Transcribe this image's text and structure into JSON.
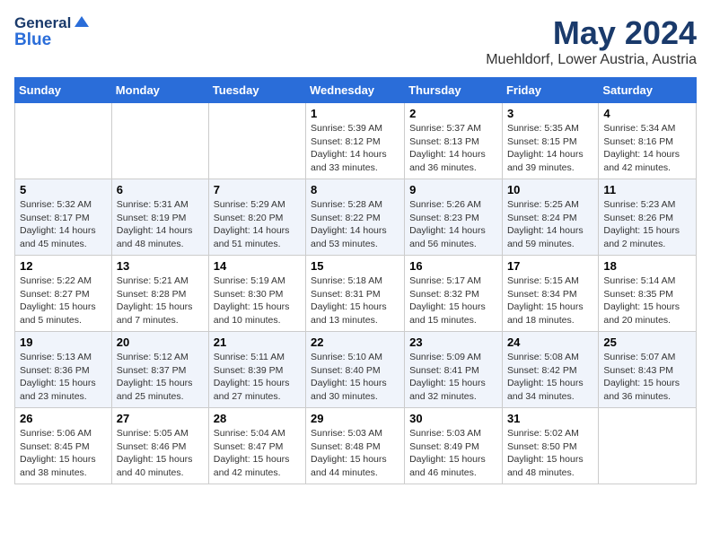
{
  "header": {
    "logo_general": "General",
    "logo_blue": "Blue",
    "month_title": "May 2024",
    "location": "Muehldorf, Lower Austria, Austria"
  },
  "days_of_week": [
    "Sunday",
    "Monday",
    "Tuesday",
    "Wednesday",
    "Thursday",
    "Friday",
    "Saturday"
  ],
  "weeks": [
    {
      "days": [
        {
          "num": "",
          "info": ""
        },
        {
          "num": "",
          "info": ""
        },
        {
          "num": "",
          "info": ""
        },
        {
          "num": "1",
          "info": "Sunrise: 5:39 AM\nSunset: 8:12 PM\nDaylight: 14 hours\nand 33 minutes."
        },
        {
          "num": "2",
          "info": "Sunrise: 5:37 AM\nSunset: 8:13 PM\nDaylight: 14 hours\nand 36 minutes."
        },
        {
          "num": "3",
          "info": "Sunrise: 5:35 AM\nSunset: 8:15 PM\nDaylight: 14 hours\nand 39 minutes."
        },
        {
          "num": "4",
          "info": "Sunrise: 5:34 AM\nSunset: 8:16 PM\nDaylight: 14 hours\nand 42 minutes."
        }
      ]
    },
    {
      "days": [
        {
          "num": "5",
          "info": "Sunrise: 5:32 AM\nSunset: 8:17 PM\nDaylight: 14 hours\nand 45 minutes."
        },
        {
          "num": "6",
          "info": "Sunrise: 5:31 AM\nSunset: 8:19 PM\nDaylight: 14 hours\nand 48 minutes."
        },
        {
          "num": "7",
          "info": "Sunrise: 5:29 AM\nSunset: 8:20 PM\nDaylight: 14 hours\nand 51 minutes."
        },
        {
          "num": "8",
          "info": "Sunrise: 5:28 AM\nSunset: 8:22 PM\nDaylight: 14 hours\nand 53 minutes."
        },
        {
          "num": "9",
          "info": "Sunrise: 5:26 AM\nSunset: 8:23 PM\nDaylight: 14 hours\nand 56 minutes."
        },
        {
          "num": "10",
          "info": "Sunrise: 5:25 AM\nSunset: 8:24 PM\nDaylight: 14 hours\nand 59 minutes."
        },
        {
          "num": "11",
          "info": "Sunrise: 5:23 AM\nSunset: 8:26 PM\nDaylight: 15 hours\nand 2 minutes."
        }
      ]
    },
    {
      "days": [
        {
          "num": "12",
          "info": "Sunrise: 5:22 AM\nSunset: 8:27 PM\nDaylight: 15 hours\nand 5 minutes."
        },
        {
          "num": "13",
          "info": "Sunrise: 5:21 AM\nSunset: 8:28 PM\nDaylight: 15 hours\nand 7 minutes."
        },
        {
          "num": "14",
          "info": "Sunrise: 5:19 AM\nSunset: 8:30 PM\nDaylight: 15 hours\nand 10 minutes."
        },
        {
          "num": "15",
          "info": "Sunrise: 5:18 AM\nSunset: 8:31 PM\nDaylight: 15 hours\nand 13 minutes."
        },
        {
          "num": "16",
          "info": "Sunrise: 5:17 AM\nSunset: 8:32 PM\nDaylight: 15 hours\nand 15 minutes."
        },
        {
          "num": "17",
          "info": "Sunrise: 5:15 AM\nSunset: 8:34 PM\nDaylight: 15 hours\nand 18 minutes."
        },
        {
          "num": "18",
          "info": "Sunrise: 5:14 AM\nSunset: 8:35 PM\nDaylight: 15 hours\nand 20 minutes."
        }
      ]
    },
    {
      "days": [
        {
          "num": "19",
          "info": "Sunrise: 5:13 AM\nSunset: 8:36 PM\nDaylight: 15 hours\nand 23 minutes."
        },
        {
          "num": "20",
          "info": "Sunrise: 5:12 AM\nSunset: 8:37 PM\nDaylight: 15 hours\nand 25 minutes."
        },
        {
          "num": "21",
          "info": "Sunrise: 5:11 AM\nSunset: 8:39 PM\nDaylight: 15 hours\nand 27 minutes."
        },
        {
          "num": "22",
          "info": "Sunrise: 5:10 AM\nSunset: 8:40 PM\nDaylight: 15 hours\nand 30 minutes."
        },
        {
          "num": "23",
          "info": "Sunrise: 5:09 AM\nSunset: 8:41 PM\nDaylight: 15 hours\nand 32 minutes."
        },
        {
          "num": "24",
          "info": "Sunrise: 5:08 AM\nSunset: 8:42 PM\nDaylight: 15 hours\nand 34 minutes."
        },
        {
          "num": "25",
          "info": "Sunrise: 5:07 AM\nSunset: 8:43 PM\nDaylight: 15 hours\nand 36 minutes."
        }
      ]
    },
    {
      "days": [
        {
          "num": "26",
          "info": "Sunrise: 5:06 AM\nSunset: 8:45 PM\nDaylight: 15 hours\nand 38 minutes."
        },
        {
          "num": "27",
          "info": "Sunrise: 5:05 AM\nSunset: 8:46 PM\nDaylight: 15 hours\nand 40 minutes."
        },
        {
          "num": "28",
          "info": "Sunrise: 5:04 AM\nSunset: 8:47 PM\nDaylight: 15 hours\nand 42 minutes."
        },
        {
          "num": "29",
          "info": "Sunrise: 5:03 AM\nSunset: 8:48 PM\nDaylight: 15 hours\nand 44 minutes."
        },
        {
          "num": "30",
          "info": "Sunrise: 5:03 AM\nSunset: 8:49 PM\nDaylight: 15 hours\nand 46 minutes."
        },
        {
          "num": "31",
          "info": "Sunrise: 5:02 AM\nSunset: 8:50 PM\nDaylight: 15 hours\nand 48 minutes."
        },
        {
          "num": "",
          "info": ""
        }
      ]
    }
  ]
}
